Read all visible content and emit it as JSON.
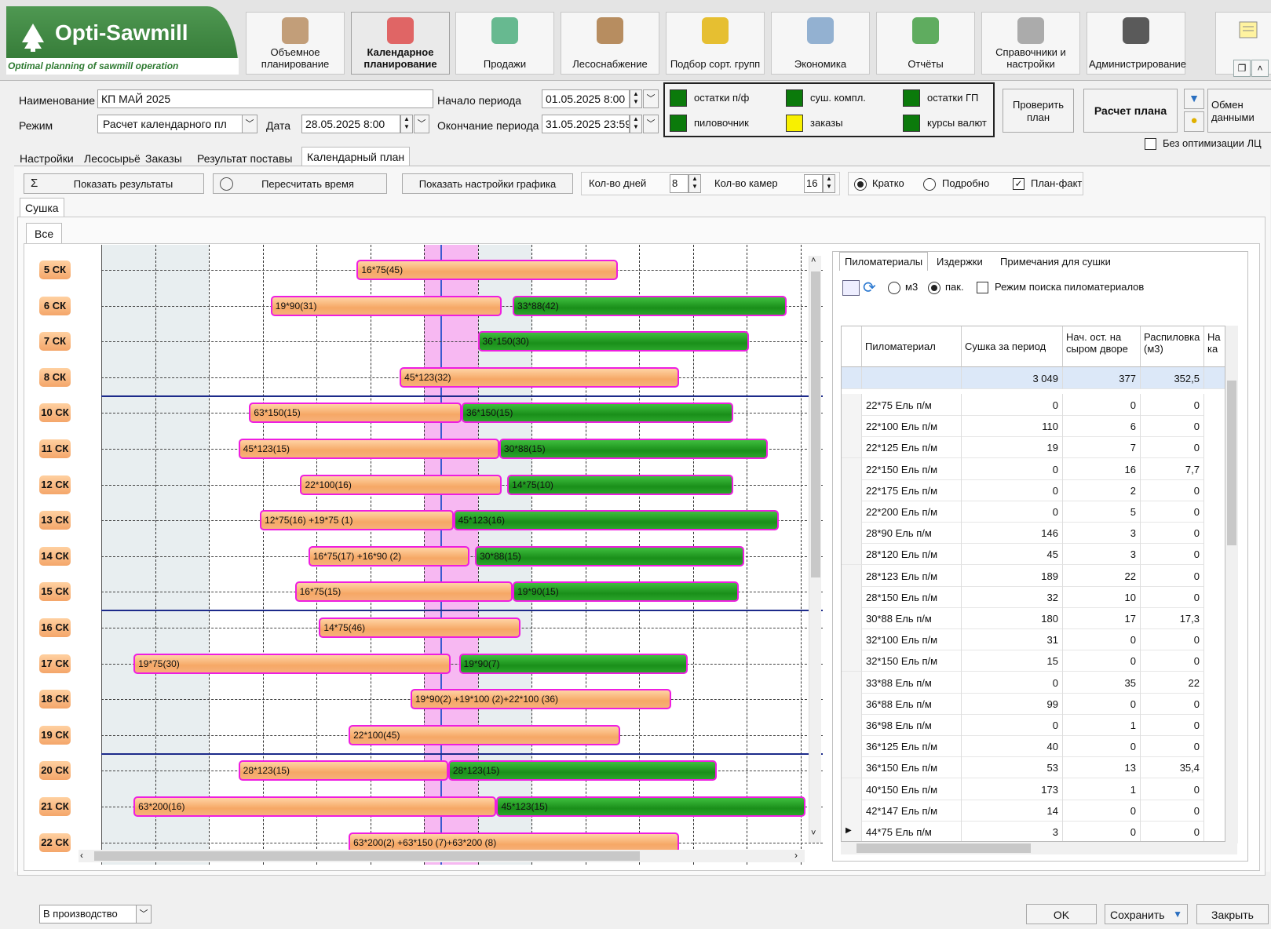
{
  "logo": {
    "title": "Opti-Sawmill",
    "subtitle": "Optimal planning of sawmill operation"
  },
  "ribbon": [
    {
      "label": "Объемное планирование",
      "icon": "logs-icon",
      "active": false
    },
    {
      "label": "Календарное планирование",
      "icon": "calendar-clock-icon",
      "active": true
    },
    {
      "label": "Продажи",
      "icon": "money-icon",
      "active": false
    },
    {
      "label": "Лесоснабжение",
      "icon": "wood-pile-icon",
      "active": false
    },
    {
      "label": "Подбор сорт. групп",
      "icon": "tape-measure-icon",
      "active": false
    },
    {
      "label": "Экономика",
      "icon": "calculator-icon",
      "active": false
    },
    {
      "label": "Отчёты",
      "icon": "report-chart-icon",
      "active": false
    },
    {
      "label": "Справочники и настройки",
      "icon": "gears-icon",
      "active": false
    },
    {
      "label": "Администрирование",
      "icon": "monitor-icon",
      "active": false
    }
  ],
  "form": {
    "name_label": "Наименование",
    "name_value": "КП МАЙ 2025",
    "mode_label": "Режим",
    "mode_value": "Расчет календарного пл",
    "date_label": "Дата",
    "date_value": "28.05.2025 8:00",
    "start_label": "Начало периода",
    "start_value": "01.05.2025 8:00",
    "end_label": "Окончание периода",
    "end_value": "31.05.2025 23:59"
  },
  "legend": [
    {
      "label": "остатки п/ф",
      "color": "#0b7a0b"
    },
    {
      "label": "суш. компл.",
      "color": "#0b7a0b"
    },
    {
      "label": "остатки ГП",
      "color": "#0b7a0b"
    },
    {
      "label": "пиловочник",
      "color": "#0b7a0b"
    },
    {
      "label": "заказы",
      "color": "#f8f000"
    },
    {
      "label": "курсы валют",
      "color": "#0b7a0b"
    }
  ],
  "actions": {
    "check": "Проверить план",
    "calc": "Расчет плана",
    "exchange": "Обмен данными",
    "no_opt": "Без оптимизации ЛЦ"
  },
  "tabs": [
    "Настройки",
    "Лесосырьё",
    "Заказы",
    "Результат поставы",
    "Календарный план"
  ],
  "toolbar": {
    "show_results": "Показать результаты",
    "recalc": "Пересчитать время",
    "show_settings": "Показать настройки графика",
    "days_label": "Кол-во дней",
    "days_value": "8",
    "chambers_label": "Кол-во камер",
    "chambers_value": "16",
    "brief": "Кратко",
    "detailed": "Подробно",
    "planfact": "План-факт"
  },
  "subtab": "Сушка",
  "subtab2": "Все",
  "gantt": {
    "rows": [
      "5 СК",
      "6 СК",
      "7 СК",
      "8 СК",
      "10 СК",
      "11 СК",
      "12 СК",
      "13 СК",
      "14 СК",
      "15 СК",
      "16 СК",
      "17 СК",
      "18 СК",
      "19 СК",
      "20 СК",
      "21 СК",
      "22 СК"
    ],
    "bars": [
      {
        "row": 0,
        "start": 4.75,
        "end": 9.6,
        "type": "orange",
        "label": "16*75(45)"
      },
      {
        "row": 1,
        "start": 3.15,
        "end": 7.45,
        "type": "orange",
        "label": "19*90(31)"
      },
      {
        "row": 1,
        "start": 7.65,
        "end": 12.75,
        "type": "green",
        "label": "33*88(42)"
      },
      {
        "row": 2,
        "start": 7.0,
        "end": 12.05,
        "type": "green",
        "label": "36*150(30)"
      },
      {
        "row": 3,
        "start": 5.55,
        "end": 10.75,
        "type": "orange",
        "label": "45*123(32)"
      },
      {
        "row": 4,
        "start": 2.75,
        "end": 6.7,
        "type": "orange",
        "label": "63*150(15)"
      },
      {
        "row": 4,
        "start": 6.7,
        "end": 11.75,
        "type": "green",
        "label": "36*150(15)"
      },
      {
        "row": 5,
        "start": 2.55,
        "end": 7.4,
        "type": "orange",
        "label": "45*123(15)"
      },
      {
        "row": 5,
        "start": 7.4,
        "end": 12.4,
        "type": "green",
        "label": "30*88(15)"
      },
      {
        "row": 6,
        "start": 3.7,
        "end": 7.45,
        "type": "orange",
        "label": "22*100(16)"
      },
      {
        "row": 6,
        "start": 7.55,
        "end": 11.75,
        "type": "green",
        "label": "14*75(10)"
      },
      {
        "row": 7,
        "start": 2.95,
        "end": 6.55,
        "type": "orange",
        "label": "12*75(16) +19*75 (1)"
      },
      {
        "row": 7,
        "start": 6.55,
        "end": 12.6,
        "type": "green",
        "label": "45*123(16)"
      },
      {
        "row": 8,
        "start": 3.85,
        "end": 6.85,
        "type": "orange",
        "label": "16*75(17) +16*90 (2)"
      },
      {
        "row": 8,
        "start": 6.95,
        "end": 11.95,
        "type": "green",
        "label": "30*88(15)"
      },
      {
        "row": 9,
        "start": 3.6,
        "end": 7.65,
        "type": "orange",
        "label": "16*75(15)"
      },
      {
        "row": 9,
        "start": 7.65,
        "end": 11.85,
        "type": "green",
        "label": "19*90(15)"
      },
      {
        "row": 10,
        "start": 4.05,
        "end": 7.8,
        "type": "orange",
        "label": "14*75(46)"
      },
      {
        "row": 11,
        "start": 0.6,
        "end": 6.5,
        "type": "orange",
        "label": "19*75(30)"
      },
      {
        "row": 11,
        "start": 6.65,
        "end": 10.9,
        "type": "green",
        "label": "19*90(7)"
      },
      {
        "row": 12,
        "start": 5.75,
        "end": 10.6,
        "type": "orange",
        "label": "19*90(2) +19*100 (2)+22*100 (36)"
      },
      {
        "row": 13,
        "start": 4.6,
        "end": 9.65,
        "type": "orange",
        "label": "22*100(45)"
      },
      {
        "row": 14,
        "start": 2.55,
        "end": 6.45,
        "type": "orange",
        "label": "28*123(15)"
      },
      {
        "row": 14,
        "start": 6.45,
        "end": 11.45,
        "type": "green",
        "label": "28*123(15)"
      },
      {
        "row": 15,
        "start": 0.6,
        "end": 7.35,
        "type": "orange",
        "label": "63*200(16)"
      },
      {
        "row": 15,
        "start": 7.35,
        "end": 13.1,
        "type": "green",
        "label": "45*123(15)"
      },
      {
        "row": 16,
        "start": 4.6,
        "end": 10.75,
        "type": "orange",
        "label": "63*200(2) +63*150 (7)+63*200 (8)"
      }
    ]
  },
  "right": {
    "tabs": [
      "Пиломатериалы",
      "Издержки",
      "Примечания для сушки"
    ],
    "opt_m3": "м3",
    "opt_pak": "пак.",
    "search_mode": "Режим поиска пиломатериалов",
    "columns": [
      "Пиломатериал",
      "Сушка за период",
      "Нач. ост. на сыром дворе",
      "Распиловка (м3)",
      "На ка"
    ],
    "totals": [
      "",
      "3 049",
      "377",
      "352,5"
    ],
    "rows": [
      [
        "22*75 Ель п/м",
        "0",
        "0",
        "0"
      ],
      [
        "22*100 Ель п/м",
        "110",
        "6",
        "0"
      ],
      [
        "22*125 Ель п/м",
        "19",
        "7",
        "0"
      ],
      [
        "22*150 Ель п/м",
        "0",
        "16",
        "7,7"
      ],
      [
        "22*175 Ель п/м",
        "0",
        "2",
        "0"
      ],
      [
        "22*200 Ель п/м",
        "0",
        "5",
        "0"
      ],
      [
        "28*90 Ель п/м",
        "146",
        "3",
        "0"
      ],
      [
        "28*120 Ель п/м",
        "45",
        "3",
        "0"
      ],
      [
        "28*123 Ель п/м",
        "189",
        "22",
        "0"
      ],
      [
        "28*150 Ель п/м",
        "32",
        "10",
        "0"
      ],
      [
        "30*88 Ель п/м",
        "180",
        "17",
        "17,3"
      ],
      [
        "32*100 Ель п/м",
        "31",
        "0",
        "0"
      ],
      [
        "32*150 Ель п/м",
        "15",
        "0",
        "0"
      ],
      [
        "33*88 Ель п/м",
        "0",
        "35",
        "22"
      ],
      [
        "36*88 Ель п/м",
        "99",
        "0",
        "0"
      ],
      [
        "36*98 Ель п/м",
        "0",
        "1",
        "0"
      ],
      [
        "36*125 Ель п/м",
        "40",
        "0",
        "0"
      ],
      [
        "36*150 Ель п/м",
        "53",
        "13",
        "35,4"
      ],
      [
        "40*150 Ель п/м",
        "173",
        "1",
        "0"
      ],
      [
        "42*147 Ель п/м",
        "14",
        "0",
        "0"
      ],
      [
        "44*75 Ель п/м",
        "3",
        "0",
        "0"
      ]
    ]
  },
  "bottom": {
    "status": "В производство",
    "ok": "OK",
    "save": "Сохранить",
    "close": "Закрыть"
  }
}
